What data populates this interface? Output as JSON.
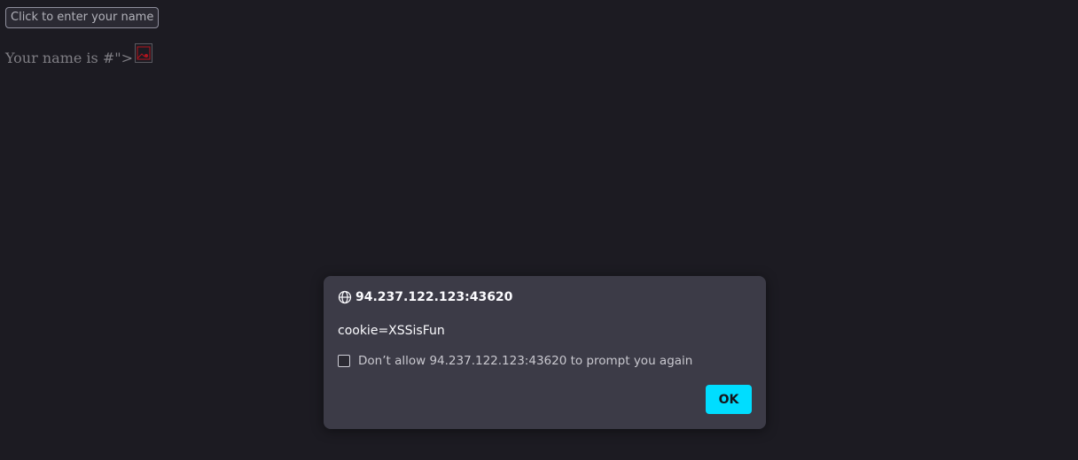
{
  "page": {
    "name_button_label": "Click to enter your name",
    "name_line_text": "Your name is #\">",
    "broken_image_icon": "broken-image-icon"
  },
  "dialog": {
    "origin": "94.237.122.123:43620",
    "origin_icon": "globe-icon",
    "message": "cookie=XSSisFun",
    "checkbox_label": "Don’t allow 94.237.122.123:43620 to prompt you again",
    "checkbox_checked": false,
    "ok_label": "OK"
  },
  "colors": {
    "background": "#1c1b22",
    "dialog_background": "#3c3b47",
    "ok_button": "#00ddff"
  }
}
